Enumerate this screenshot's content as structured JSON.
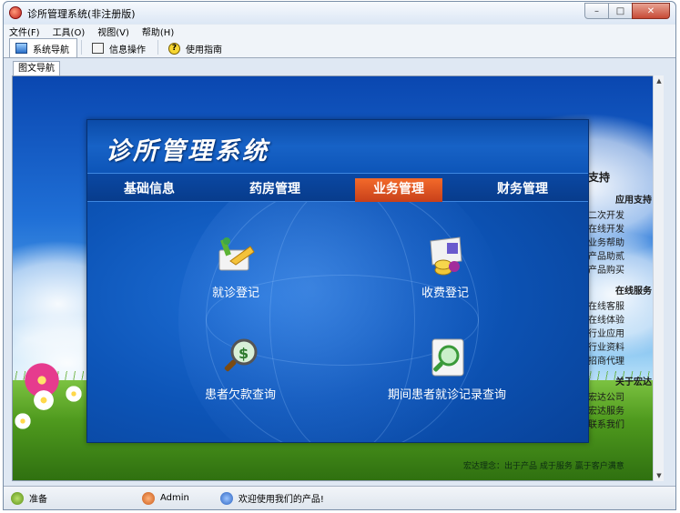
{
  "window": {
    "title": "诊所管理系统(非注册版)"
  },
  "menu": [
    "文件(F)",
    "工具(O)",
    "视图(V)",
    "帮助(H)"
  ],
  "toolbar": {
    "tabs": [
      {
        "label": "系统导航",
        "icon": "monitor-icon",
        "active": true
      },
      {
        "label": "信息操作",
        "icon": "document-icon",
        "active": false
      },
      {
        "label": "使用指南",
        "icon": "help-icon",
        "active": false
      }
    ]
  },
  "content_tab": {
    "label": "图文导航"
  },
  "panel": {
    "title": "诊所管理系统",
    "nav": [
      "基础信息",
      "药房管理",
      "业务管理",
      "财务管理"
    ],
    "active_nav": "业务管理",
    "functions": [
      {
        "label": "就诊登记",
        "icon": "registration-icon"
      },
      {
        "label": "收费登记",
        "icon": "charge-icon"
      },
      {
        "label": "患者欠款查询",
        "icon": "debt-search-icon"
      },
      {
        "label": "期间患者就诊记录查询",
        "icon": "record-search-icon"
      }
    ]
  },
  "side": {
    "heading": "支持",
    "sections": [
      {
        "title": "应用支持",
        "links": [
          "二次开发",
          "在线开发",
          "业务帮助",
          "产品助贰",
          "产品购买"
        ]
      },
      {
        "title": "在线服务",
        "links": [
          "在线客服",
          "在线体验",
          "行业应用",
          "行业资料",
          "招商代理"
        ]
      },
      {
        "title": "关于宏达",
        "links": [
          "宏达公司",
          "宏达服务",
          "联系我们"
        ]
      }
    ],
    "footer": "宏达理念：出于产品 成于服务 赢于客户满意"
  },
  "status": {
    "ready": "准备",
    "user": "Admin",
    "message": "欢迎使用我们的产品!"
  },
  "colors": {
    "accent": "#d04a1c",
    "panel_blue": "#0d55b8"
  }
}
